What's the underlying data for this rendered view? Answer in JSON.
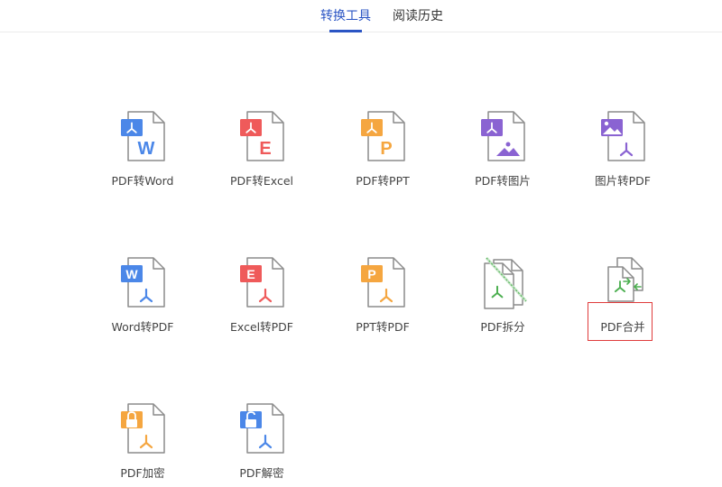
{
  "tabs": [
    {
      "label": "转换工具",
      "active": true
    },
    {
      "label": "阅读历史",
      "active": false
    }
  ],
  "tools": [
    {
      "label": "PDF转Word",
      "icon": "pdf-to-word-icon",
      "badge": "pdf",
      "letter": "W",
      "color": "#4b87e8",
      "lower": "letter"
    },
    {
      "label": "PDF转Excel",
      "icon": "pdf-to-excel-icon",
      "badge": "pdf",
      "letter": "E",
      "color": "#ef5a5a",
      "lower": "letter"
    },
    {
      "label": "PDF转PPT",
      "icon": "pdf-to-ppt-icon",
      "badge": "pdf",
      "letter": "P",
      "color": "#f5a640",
      "lower": "letter"
    },
    {
      "label": "PDF转图片",
      "icon": "pdf-to-image-icon",
      "badge": "pdf",
      "letter": "",
      "color": "#8a63d2",
      "lower": "mountain"
    },
    {
      "label": "图片转PDF",
      "icon": "image-to-pdf-icon",
      "badge": "image",
      "letter": "",
      "color": "#8a63d2",
      "lower": "pdf"
    },
    {
      "label": "Word转PDF",
      "icon": "word-to-pdf-icon",
      "badge": "letter",
      "letter": "W",
      "color": "#4b87e8",
      "lower": "pdf"
    },
    {
      "label": "Excel转PDF",
      "icon": "excel-to-pdf-icon",
      "badge": "letter",
      "letter": "E",
      "color": "#ef5a5a",
      "lower": "pdf"
    },
    {
      "label": "PPT转PDF",
      "icon": "ppt-to-pdf-icon",
      "badge": "letter",
      "letter": "P",
      "color": "#f5a640",
      "lower": "pdf"
    },
    {
      "label": "PDF拆分",
      "icon": "pdf-split-icon",
      "badge": "none",
      "letter": "",
      "color": "#4caf50",
      "lower": "split"
    },
    {
      "label": "PDF合并",
      "icon": "pdf-merge-icon",
      "badge": "none",
      "letter": "",
      "color": "#4caf50",
      "lower": "merge"
    },
    {
      "label": "PDF加密",
      "icon": "pdf-encrypt-icon",
      "badge": "lock",
      "letter": "",
      "color": "#f5a640",
      "lower": "pdf"
    },
    {
      "label": "PDF解密",
      "icon": "pdf-decrypt-icon",
      "badge": "unlock",
      "letter": "",
      "color": "#4b87e8",
      "lower": "pdf"
    }
  ]
}
